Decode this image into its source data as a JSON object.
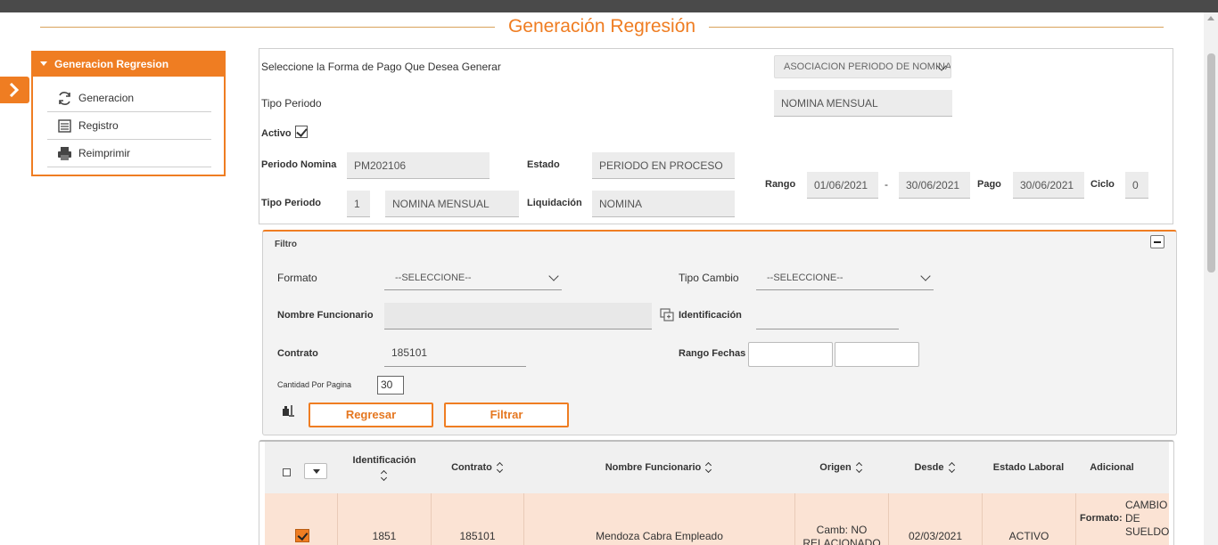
{
  "page": {
    "title": "Generación Regresión"
  },
  "menu": {
    "header": "Generacion Regresion",
    "items": [
      {
        "label": "Generacion",
        "icon": "refresh-icon"
      },
      {
        "label": "Registro",
        "icon": "list-icon"
      },
      {
        "label": "Reimprimir",
        "icon": "printer-icon"
      }
    ]
  },
  "header_form": {
    "forma_pago_label": "Seleccione la Forma de Pago Que Desea Generar",
    "forma_pago_value": "ASOCIACION PERIODO DE NOMINA",
    "tipo_periodo_label": "Tipo Periodo",
    "tipo_periodo_value": "NOMINA MENSUAL",
    "activo_label": "Activo",
    "activo_checked": true,
    "periodo_nomina_label": "Periodo Nomina",
    "periodo_nomina_value": "PM202106",
    "estado_label": "Estado",
    "estado_value": "PERIODO EN PROCESO",
    "tipo_periodo2_label": "Tipo Periodo",
    "tipo_periodo2_code": "1",
    "tipo_periodo2_value": "NOMINA MENSUAL",
    "liquidacion_label": "Liquidación",
    "liquidacion_value": "NOMINA",
    "rango_label": "Rango",
    "rango_desde": "01/06/2021",
    "rango_sep": "-",
    "rango_hasta": "30/06/2021",
    "pago_label": "Pago",
    "pago_value": "30/06/2021",
    "ciclo_label": "Ciclo",
    "ciclo_value": "0"
  },
  "filtro": {
    "title": "Filtro",
    "formato_label": "Formato",
    "formato_value": "--SELECCIONE--",
    "tipo_cambio_label": "Tipo Cambio",
    "tipo_cambio_value": "--SELECCIONE--",
    "nombre_label": "Nombre Funcionario",
    "nombre_value": "",
    "identificacion_label": "Identificación",
    "identificacion_value": "",
    "contrato_label": "Contrato",
    "contrato_value": "185101",
    "rango_fechas_label": "Rango Fechas",
    "cantidad_label": "Cantidad Por Pagina",
    "cantidad_value": "30",
    "regresar_label": "Regresar",
    "filtrar_label": "Filtrar"
  },
  "table": {
    "columns": [
      "Identificación",
      "Contrato",
      "Nombre Funcionario",
      "Origen",
      "Desde",
      "Estado Laboral",
      "Adicional"
    ],
    "rows": [
      {
        "checked": true,
        "identificacion": "1851",
        "contrato": "185101",
        "nombre": "Mendoza Cabra Empleado",
        "origen": "Camb: NO RELACIONADO",
        "desde": "02/03/2021",
        "estado": "ACTIVO",
        "adicional_label": "Formato:",
        "adicional_value": "CAMBIO DE SUELDO"
      }
    ]
  }
}
